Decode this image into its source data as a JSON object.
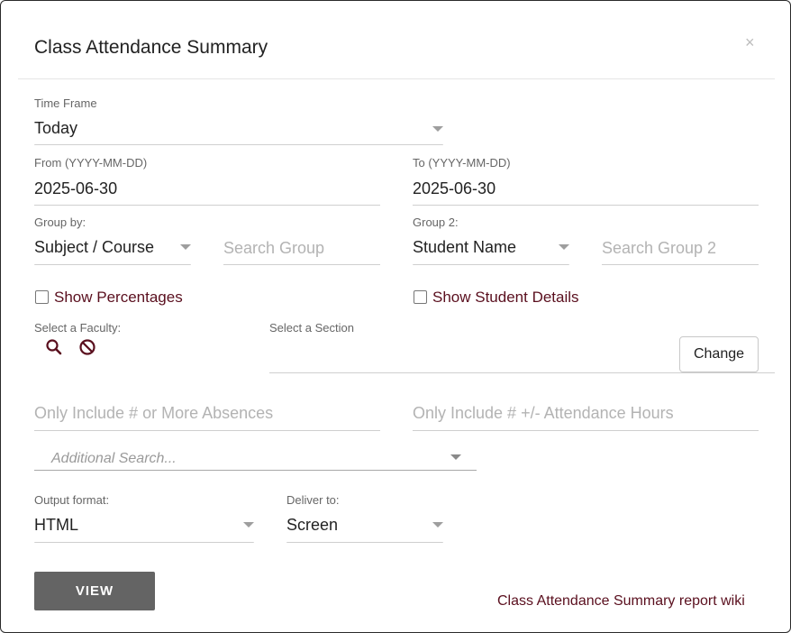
{
  "dialog": {
    "title": "Class Attendance Summary",
    "close": "×"
  },
  "time_frame": {
    "label": "Time Frame",
    "value": "Today"
  },
  "from_date": {
    "label": "From (YYYY-MM-DD)",
    "value": "2025-06-30"
  },
  "to_date": {
    "label": "To (YYYY-MM-DD)",
    "value": "2025-06-30"
  },
  "group_by": {
    "label": "Group by:",
    "value": "Subject / Course",
    "search_placeholder": "Search Group"
  },
  "group_2": {
    "label": "Group 2:",
    "value": "Student Name",
    "search_placeholder": "Search Group 2"
  },
  "show_percentages": {
    "label": "Show Percentages",
    "checked": false
  },
  "show_student_details": {
    "label": "Show Student Details",
    "checked": false
  },
  "faculty": {
    "label": "Select a Faculty:",
    "search_icon": "search-icon",
    "clear_icon": "prohibited-icon"
  },
  "section": {
    "label": "Select a Section",
    "change_label": "Change"
  },
  "absences": {
    "placeholder": "Only Include # or More Absences"
  },
  "attendance_hours": {
    "placeholder": "Only Include # +/- Attendance Hours"
  },
  "additional_search": {
    "placeholder": "Additional Search..."
  },
  "output_format": {
    "label": "Output format:",
    "value": "HTML"
  },
  "deliver_to": {
    "label": "Deliver to:",
    "value": "Screen"
  },
  "actions": {
    "view_label": "VIEW",
    "wiki_link": "Class Attendance Summary report wiki"
  },
  "colors": {
    "accent": "#5a0f1e",
    "button_gray": "#646464"
  }
}
